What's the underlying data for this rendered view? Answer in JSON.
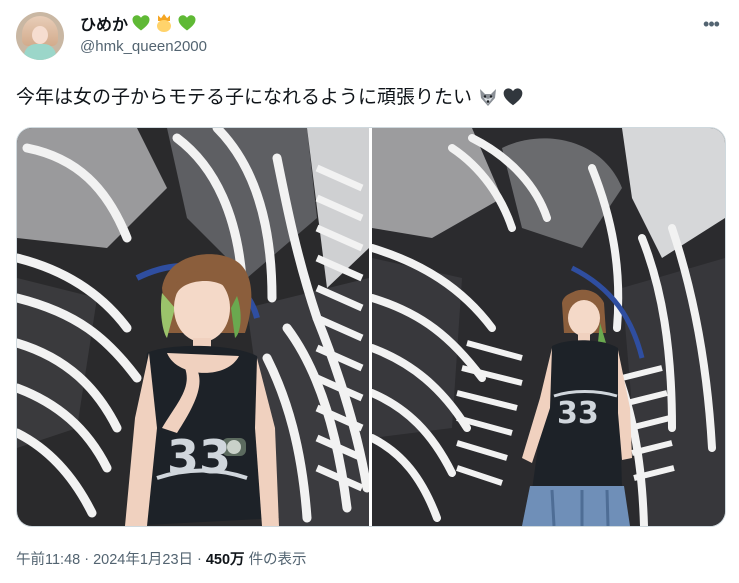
{
  "author": {
    "display_name": "ひめか",
    "name_emojis": [
      "green-heart-icon",
      "princess-icon",
      "green-heart-icon"
    ],
    "handle": "@hmk_queen2000"
  },
  "tweet": {
    "text": "今年は女の子からモテる子になれるように頑張りたい",
    "text_emojis": [
      "wolf-icon",
      "black-heart-icon"
    ]
  },
  "media": {
    "count": 2,
    "photos": [
      "photo-1",
      "photo-2"
    ]
  },
  "meta": {
    "time": "午前11:48",
    "separator": "·",
    "date": "2024年1月23日",
    "views_count": "450万",
    "views_label": "件の表示"
  },
  "colors": {
    "text_primary": "#0f1419",
    "text_secondary": "#536471",
    "border": "#cfd9de",
    "green_heart": "#5fb935",
    "black_heart": "#31373d"
  }
}
